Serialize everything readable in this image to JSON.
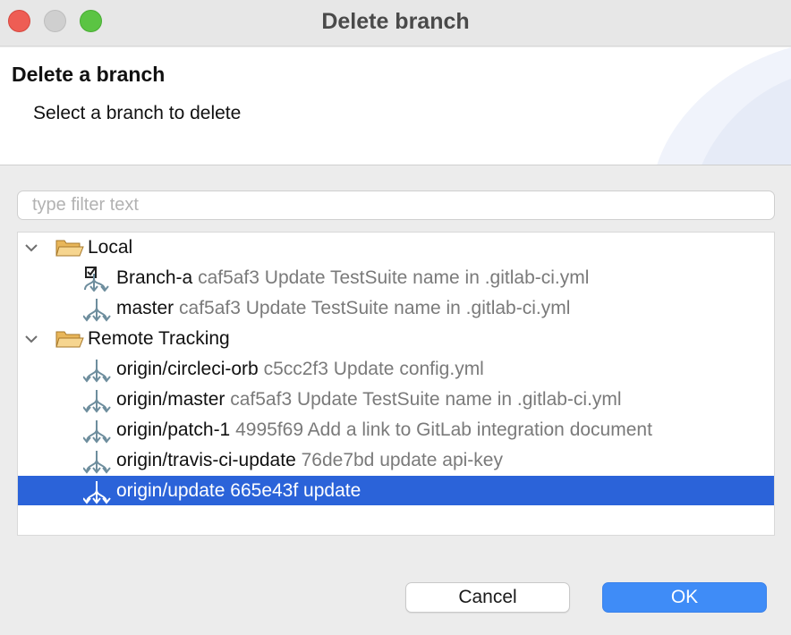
{
  "window": {
    "title": "Delete branch"
  },
  "header": {
    "title": "Delete a branch",
    "subtitle": "Select a branch to delete"
  },
  "filter": {
    "placeholder": "type filter text",
    "value": ""
  },
  "tree": {
    "groups": [
      {
        "label": "Local",
        "expanded": true,
        "branches": [
          {
            "name": "Branch-a",
            "desc": "caf5af3 Update TestSuite name in .gitlab-ci.yml",
            "checked_out": true
          },
          {
            "name": "master",
            "desc": "caf5af3 Update TestSuite name in .gitlab-ci.yml"
          }
        ]
      },
      {
        "label": "Remote Tracking",
        "expanded": true,
        "branches": [
          {
            "name": "origin/circleci-orb",
            "desc": "c5cc2f3 Update config.yml"
          },
          {
            "name": "origin/master",
            "desc": "caf5af3 Update TestSuite name in .gitlab-ci.yml"
          },
          {
            "name": "origin/patch-1",
            "desc": "4995f69 Add a link to GitLab integration document"
          },
          {
            "name": "origin/travis-ci-update",
            "desc": "76de7bd update api-key"
          },
          {
            "name": "origin/update",
            "desc": "665e43f update",
            "selected": true
          }
        ]
      }
    ]
  },
  "buttons": {
    "cancel": "Cancel",
    "ok": "OK"
  },
  "colors": {
    "selection": "#2b63d9",
    "ok_button": "#3f8cf7",
    "close_light": "#ee5d54",
    "max_light": "#5bc443"
  }
}
